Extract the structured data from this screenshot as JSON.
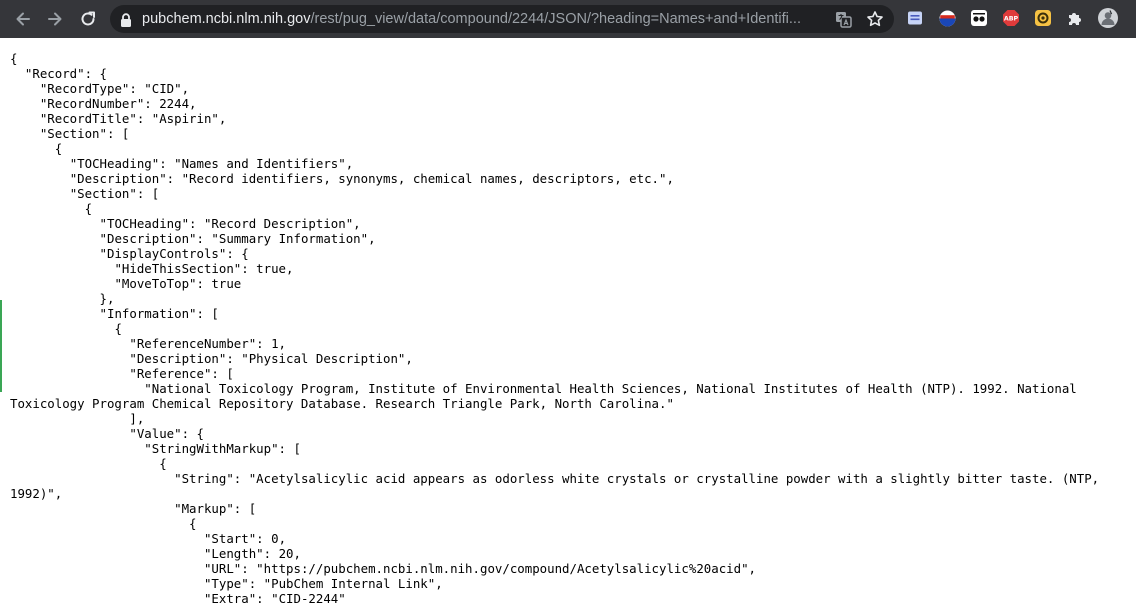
{
  "browser": {
    "url_host": "pubchem.ncbi.nlm.nih.gov",
    "url_path": "/rest/pug_view/data/compound/2244/JSON/?heading=Names+and+Identifi...",
    "icons": [
      "back-arrow-icon",
      "forward-arrow-icon",
      "reload-icon",
      "lock-icon",
      "translate-icon",
      "bookmark-star-icon",
      "reading-list-icon",
      "flag-extension-icon",
      "eyes-extension-icon",
      "adblock-plus-icon",
      "yellow-extension-icon",
      "puzzle-extension-icon",
      "profile-avatar"
    ],
    "extensions": {
      "adblock_label": "ABP"
    },
    "colors": {
      "toolbar": "#35363a",
      "omnibox": "#202124",
      "host_text": "#e8eaed",
      "path_text": "#9aa0a6"
    }
  },
  "document": {
    "json_text": "{\n  \"Record\": {\n    \"RecordType\": \"CID\",\n    \"RecordNumber\": 2244,\n    \"RecordTitle\": \"Aspirin\",\n    \"Section\": [\n      {\n        \"TOCHeading\": \"Names and Identifiers\",\n        \"Description\": \"Record identifiers, synonyms, chemical names, descriptors, etc.\",\n        \"Section\": [\n          {\n            \"TOCHeading\": \"Record Description\",\n            \"Description\": \"Summary Information\",\n            \"DisplayControls\": {\n              \"HideThisSection\": true,\n              \"MoveToTop\": true\n            },\n            \"Information\": [\n              {\n                \"ReferenceNumber\": 1,\n                \"Description\": \"Physical Description\",\n                \"Reference\": [\n                  \"National Toxicology Program, Institute of Environmental Health Sciences, National Institutes of Health (NTP). 1992. National Toxicology Program Chemical Repository Database. Research Triangle Park, North Carolina.\"\n                ],\n                \"Value\": {\n                  \"StringWithMarkup\": [\n                    {\n                      \"String\": \"Acetylsalicylic acid appears as odorless white crystals or crystalline powder with a slightly bitter taste. (NTP, 1992)\",\n                      \"Markup\": [\n                        {\n                          \"Start\": 0,\n                          \"Length\": 20,\n                          \"URL\": \"https://pubchem.ncbi.nlm.nih.gov/compound/Acetylsalicylic%20acid\",\n                          \"Type\": \"PubChem Internal Link\",\n                          \"Extra\": \"CID-2244\""
  }
}
